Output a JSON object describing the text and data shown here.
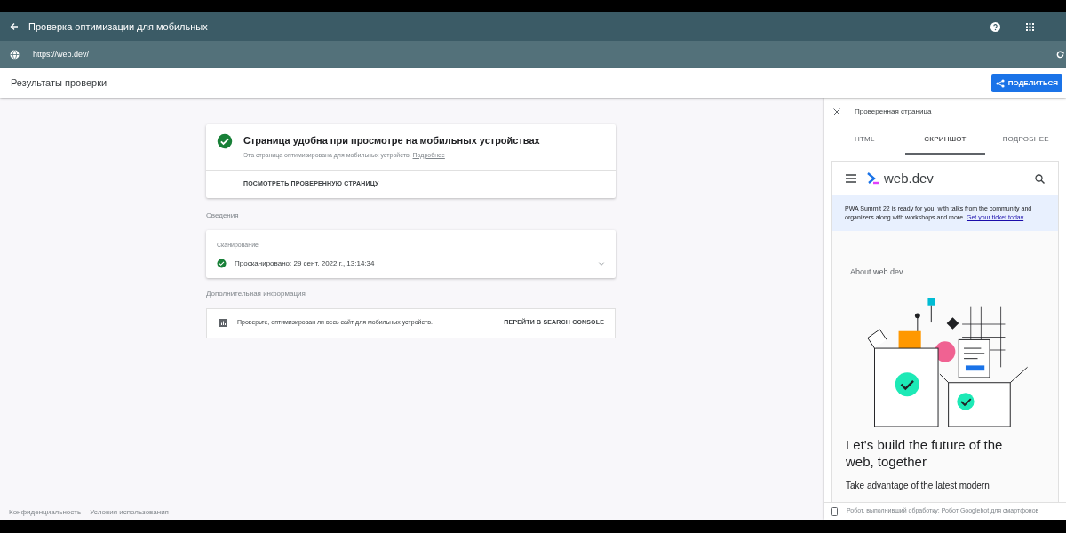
{
  "app_bar": {
    "title": "Проверка оптимизации для мобильных"
  },
  "url_bar": {
    "value": "https://web.dev/"
  },
  "subheader": {
    "title": "Результаты проверки",
    "share_button": "ПОДЕЛИТЬСЯ"
  },
  "result_card": {
    "title": "Страница удобна при просмотре на мобильных устройствах",
    "description": "Эта страница оптимизирована для мобильных устройств.",
    "link": "Подробнее",
    "action": "ПОСМОТРЕТЬ ПРОВЕРЕННУЮ СТРАНИЦУ"
  },
  "details": {
    "heading": "Сведения",
    "card_label": "Сканирование",
    "status": "Просканировано: 29 сент. 2022 г., 13:14:34",
    "expanded": false
  },
  "more_info": {
    "heading": "Дополнительная информация",
    "text": "Проверьте, оптимизирован ли весь сайт для мобильных устройств.",
    "action": "ПЕРЕЙТИ В SEARCH CONSOLE"
  },
  "footer": {
    "links": [
      "Конфиденциальность",
      "Условия использования"
    ]
  },
  "side_panel": {
    "title": "Проверенная страница",
    "tabs": [
      {
        "label": "HTML",
        "selected": false
      },
      {
        "label": "СКРИНШОТ",
        "selected": true
      },
      {
        "label": "ПОДРОБНЕЕ",
        "selected": false
      }
    ],
    "screenshot": {
      "logo": "web.dev",
      "banner": "PWA Summit 22 is ready for you, with talks from the community and organizers along with workshops and more.",
      "banner_link": "Get your ticket today",
      "section": "About web.dev",
      "headline": "Let's build the future of the web, together",
      "body": "Take advantage of the latest modern"
    },
    "status": "Робот, выполнивший обработку: Робот Googlebot для смартфонов"
  }
}
